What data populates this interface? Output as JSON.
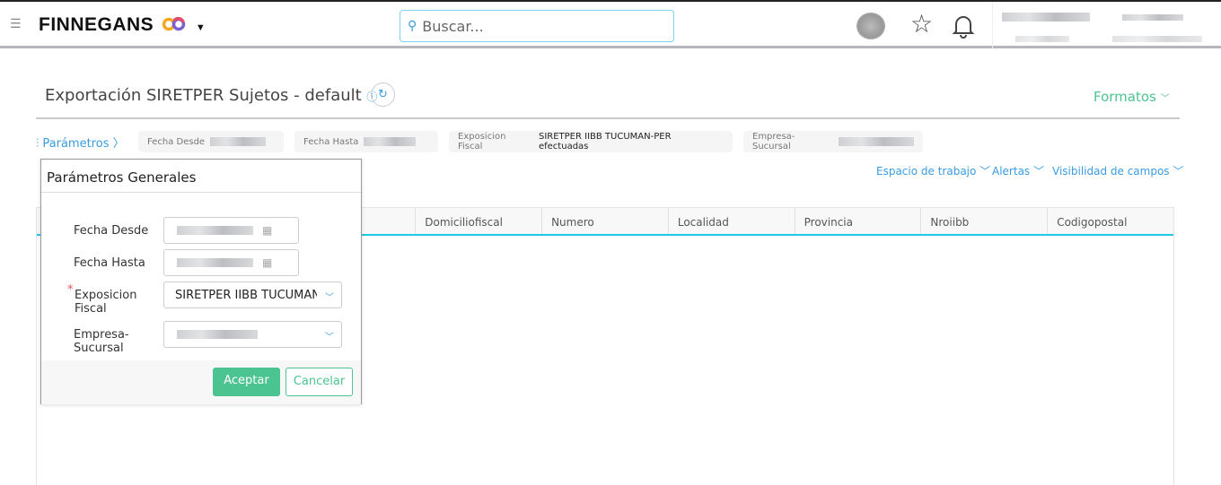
{
  "header": {
    "brand": "FINNEGANS",
    "search_placeholder": "Buscar..."
  },
  "page": {
    "title": "Exportación SIRETPER Sujetos - default",
    "formatos": "Formatos"
  },
  "params_bar": {
    "label": "Parámetros",
    "chips": [
      {
        "label": "Fecha Desde"
      },
      {
        "label": "Fecha Hasta"
      },
      {
        "label": "Exposicion Fiscal",
        "value": "SIRETPER IIBB TUCUMAN-PER efectuadas"
      },
      {
        "label": "Empresa-Sucursal"
      }
    ]
  },
  "toolbar": {
    "workspace": "Espacio de trabajo",
    "alerts": "Alertas",
    "visibility": "Visibilidad de campos"
  },
  "table": {
    "columns": [
      "Domiciliofiscal",
      "Numero",
      "Localidad",
      "Provincia",
      "Nroiibb",
      "Codigopostal"
    ]
  },
  "popup": {
    "title": "Parámetros Generales",
    "fecha_desde": "Fecha Desde",
    "fecha_hasta": "Fecha Hasta",
    "exposicion": "Exposicion Fiscal",
    "exposicion_value": "SIRETPER IIBB TUCUMAN",
    "empresa": "Empresa-Sucursal",
    "accept": "Aceptar",
    "cancel": "Cancelar",
    "required_mark": "*"
  }
}
